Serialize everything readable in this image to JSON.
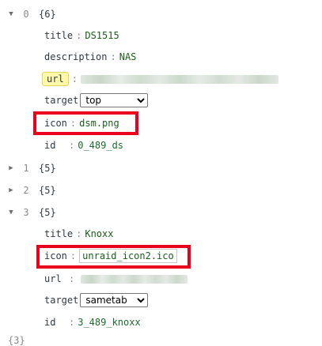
{
  "tree": {
    "nodes": [
      {
        "index": "0",
        "count": "{6}",
        "expanded": true,
        "fields": {
          "title": {
            "key": "title",
            "value": "DS1515"
          },
          "description": {
            "key": "description",
            "value": "NAS"
          },
          "url": {
            "key": "url"
          },
          "target": {
            "key": "target",
            "value": "top"
          },
          "icon": {
            "key": "icon",
            "value": "dsm.png"
          },
          "id": {
            "key": "id",
            "value": "0_489_ds"
          }
        }
      },
      {
        "index": "1",
        "count": "{5}",
        "expanded": false
      },
      {
        "index": "2",
        "count": "{5}",
        "expanded": false
      },
      {
        "index": "3",
        "count": "{5}",
        "expanded": true,
        "fields": {
          "title": {
            "key": "title",
            "value": "Knoxx"
          },
          "icon": {
            "key": "icon",
            "value": "unraid_icon2.ico"
          },
          "url": {
            "key": "url"
          },
          "target": {
            "key": "target",
            "value": "sametab"
          },
          "id": {
            "key": "id",
            "value": "3_489_knoxx"
          }
        }
      }
    ],
    "separator": ":",
    "trailing_count": "{3}"
  },
  "colors": {
    "highlight_box": "#e8001c",
    "key_highlight": "#fff9a8"
  },
  "icons": {
    "expanded": "triangle-down-icon",
    "collapsed": "triangle-right-icon"
  }
}
